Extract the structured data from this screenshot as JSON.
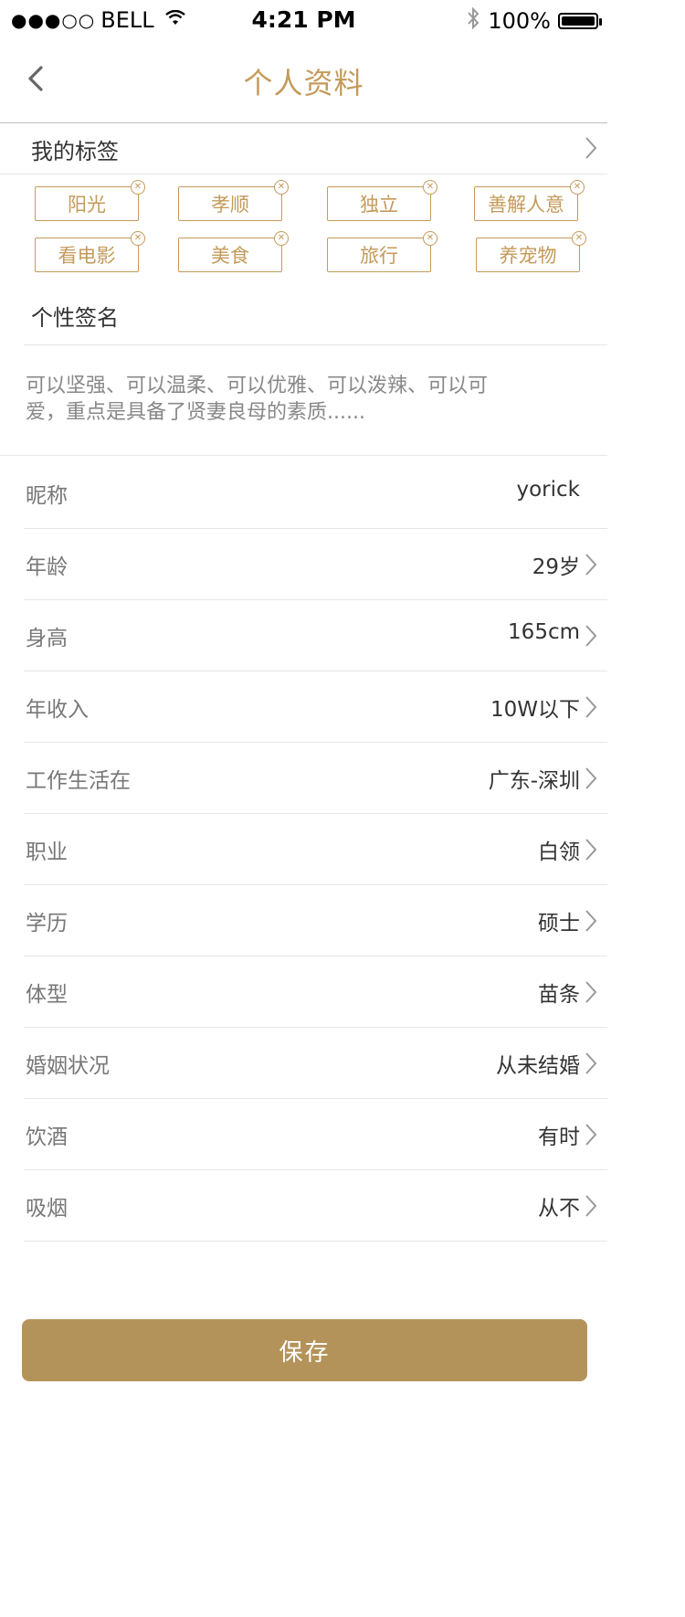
{
  "status_bar": {
    "signal": "●●●○○",
    "carrier": "BELL",
    "time": "4:21 PM",
    "battery": "100%"
  },
  "nav": {
    "title": "个人资料"
  },
  "tags": {
    "label": "我的标签",
    "items": [
      "阳光",
      "孝顺",
      "独立",
      "善解人意",
      "看电影",
      "美食",
      "旅行",
      "养宠物"
    ]
  },
  "signature": {
    "title": "个性签名",
    "line1": "可以坚强、可以温柔、可以优雅、可以泼辣、可以可",
    "line2": "爱，重点是具备了贤妻良母的素质......"
  },
  "info_rows": [
    {
      "label": "昵称",
      "value": "yorick"
    },
    {
      "label": "年龄",
      "value": "29岁"
    },
    {
      "label": "身高",
      "value": "165cm"
    },
    {
      "label": "年收入",
      "value": "10W以下"
    },
    {
      "label": "工作生活在",
      "value": "广东-深圳"
    },
    {
      "label": "职业",
      "value": "白领"
    },
    {
      "label": "学历",
      "value": "硕士"
    },
    {
      "label": "体型",
      "value": "苗条"
    },
    {
      "label": "婚姻状况",
      "value": "从未结婚"
    },
    {
      "label": "饮酒",
      "value": "有时"
    },
    {
      "label": "吸烟",
      "value": "从不"
    }
  ],
  "actions": {
    "save_label": "保存"
  },
  "colors": {
    "accent": "#c49a5a",
    "save_button": "#b4935a"
  }
}
